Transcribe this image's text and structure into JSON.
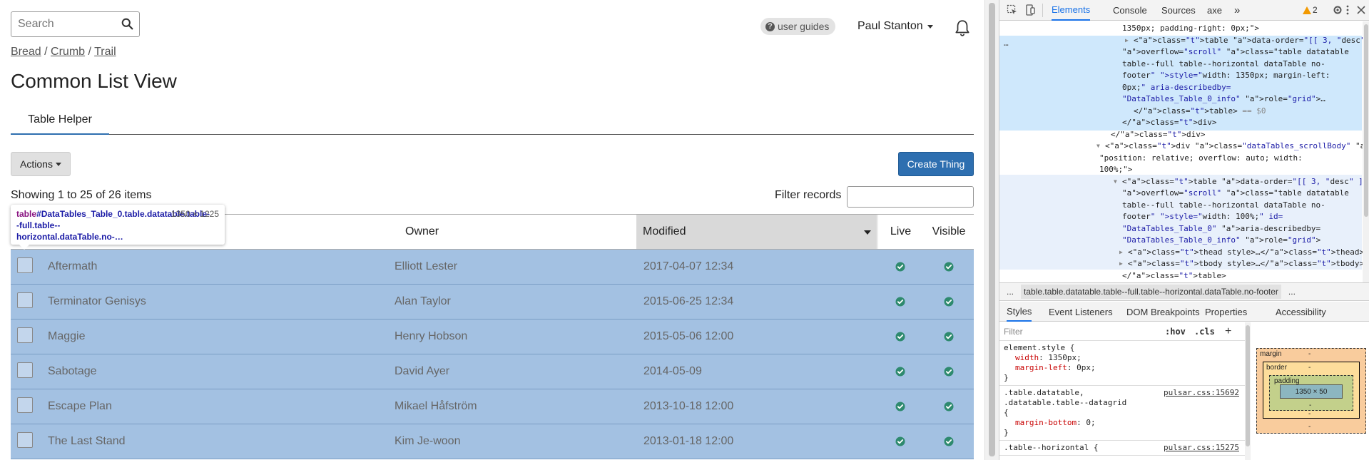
{
  "header": {
    "search_placeholder": "Search",
    "user_guides": "user guides",
    "user_name": "Paul Stanton"
  },
  "breadcrumb": [
    "Bread",
    "Crumb",
    "Trail"
  ],
  "page_title": "Common List View",
  "tabs": [
    "Table Helper"
  ],
  "toolbar": {
    "actions_label": "Actions",
    "create_label": "Create Thing"
  },
  "list": {
    "showing_text": "Showing 1 to 25 of 26 items",
    "filter_label": "Filter records",
    "filter_value": ""
  },
  "table": {
    "columns": [
      "",
      "Owner",
      "Modified",
      "Live",
      "Visible"
    ],
    "rows": [
      {
        "title": "Aftermath",
        "owner": "Elliott Lester",
        "modified": "2017-04-07 12:34"
      },
      {
        "title": "Terminator Genisys",
        "owner": "Alan Taylor",
        "modified": "2015-06-25 12:34"
      },
      {
        "title": "Maggie",
        "owner": "Henry Hobson",
        "modified": "2015-05-06 12:00"
      },
      {
        "title": "Sabotage",
        "owner": "David Ayer",
        "modified": "2014-05-09"
      },
      {
        "title": "Escape Plan",
        "owner": "Mikael Håfström",
        "modified": "2013-10-18 12:00"
      },
      {
        "title": "The Last Stand",
        "owner": "Kim Je-woon",
        "modified": "2013-01-18 12:00"
      }
    ]
  },
  "highlight_tooltip": {
    "tag": "table",
    "selector": "#DataTables_Table_0.table.datatable.table--full.table--horizontal.dataTable.no-…",
    "dimensions": "1350 × 1225"
  },
  "devtools": {
    "tabs": [
      "Elements",
      "Console",
      "Sources",
      "axe"
    ],
    "more_tabs": "»",
    "warning_count": "2",
    "dom_lines": [
      "1350px; padding-right: 0px;\">",
      "<table data-order=\"[[ 3, \"desc\" ]]\" data-",
      "overflow=\"scroll\" class=\"table datatable",
      "table--full table--horizontal dataTable no-",
      "footer\" style=\"width: 1350px; margin-left:",
      "0px;\" aria-describedby=",
      "\"DataTables_Table_0_info\" role=\"grid\">…",
      "</table> == $0",
      "</div>",
      "</div>",
      "<div class=\"dataTables_scrollBody\" style=",
      "\"position: relative; overflow: auto; width:",
      "100%;\">",
      "<table data-order=\"[[ 3, \"desc\" ]]\" data-",
      "overflow=\"scroll\" class=\"table datatable",
      "table--full table--horizontal dataTable no-",
      "footer\" style=\"width: 100%;\" id=",
      "\"DataTables_Table_0\" aria-describedby=",
      "\"DataTables_Table_0_info\" role=\"grid\">",
      "<thead style>…</thead>",
      "<tbody style>…</tbody>",
      "</table>"
    ],
    "breadcrumb_current": "table.table.datatable.table--full.table--horizontal.dataTable.no-footer",
    "ellipsis": "...",
    "sub_tabs": [
      "Styles",
      "Event Listeners",
      "DOM Breakpoints",
      "Properties",
      "Accessibility"
    ],
    "styles_filter_placeholder": "Filter",
    "hov": ":hov",
    "cls": ".cls",
    "rules": [
      {
        "selector": "element.style {",
        "props": [
          [
            "width",
            "1350px"
          ],
          [
            "margin-left",
            "0px"
          ]
        ],
        "source": ""
      },
      {
        "selector": ".table.datatable,\n.datatable.table--datagrid\n{",
        "props": [
          [
            "margin-bottom",
            "0"
          ]
        ],
        "source": "pulsar.css:15692"
      },
      {
        "selector": ".table--horizontal {",
        "props": [],
        "source": "pulsar.css:15275"
      }
    ],
    "box_model": {
      "margin": "margin",
      "border": "border",
      "padding": "padding",
      "content": "1350 × 50",
      "dash": "-"
    }
  },
  "colors": {
    "accent": "#2e6fb0",
    "row_highlight": "#a3c1e2",
    "check_green": "#2e8a6e",
    "devtools_active": "#1a73e8"
  }
}
